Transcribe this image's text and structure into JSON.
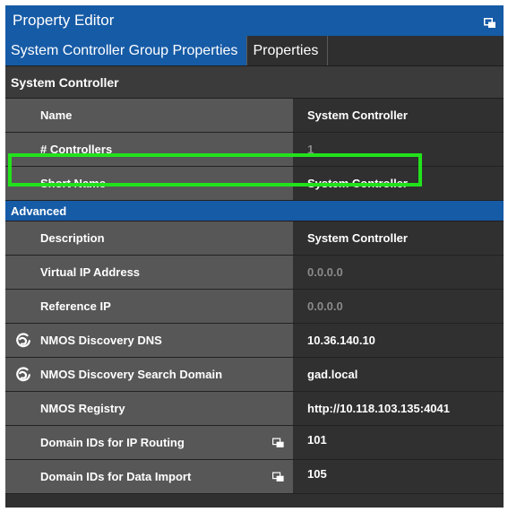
{
  "window": {
    "title": "Property Editor",
    "undock_icon": "undock-window-icon"
  },
  "tabs": [
    {
      "label": "System Controller Group Properties",
      "active": true
    },
    {
      "label": "Properties",
      "active": false
    }
  ],
  "sections": {
    "system_controller": "System Controller",
    "advanced": "Advanced"
  },
  "rows": {
    "name": {
      "label": "Name",
      "value": "System Controller"
    },
    "controllers": {
      "label": "# Controllers",
      "value": "1"
    },
    "short_name": {
      "label": "Short Name",
      "value": "System Controller"
    },
    "description": {
      "label": "Description",
      "value": "System Controller"
    },
    "virtual_ip": {
      "label": "Virtual IP Address",
      "value": "0.0.0.0"
    },
    "reference_ip": {
      "label": "Reference IP",
      "value": "0.0.0.0"
    },
    "nmos_dns": {
      "label": "NMOS Discovery DNS",
      "value": "10.36.140.10",
      "icon": "nmos-icon"
    },
    "nmos_search_domain": {
      "label": "NMOS Discovery Search Domain",
      "value": "gad.local",
      "icon": "nmos-icon"
    },
    "nmos_registry": {
      "label": "NMOS Registry",
      "value": "http://10.118.103.135:4041"
    },
    "domain_ip_routing": {
      "label": "Domain IDs for IP Routing",
      "value": "101",
      "icon": "multi-value-icon"
    },
    "domain_data_import": {
      "label": "Domain IDs for Data Import",
      "value": "105",
      "icon": "multi-value-icon"
    }
  },
  "colors": {
    "accent_blue": "#165ba6",
    "highlight_green": "#22e21b",
    "label_bg": "#575757",
    "value_bg": "#303030",
    "dim_text": "#8a8a8a"
  }
}
